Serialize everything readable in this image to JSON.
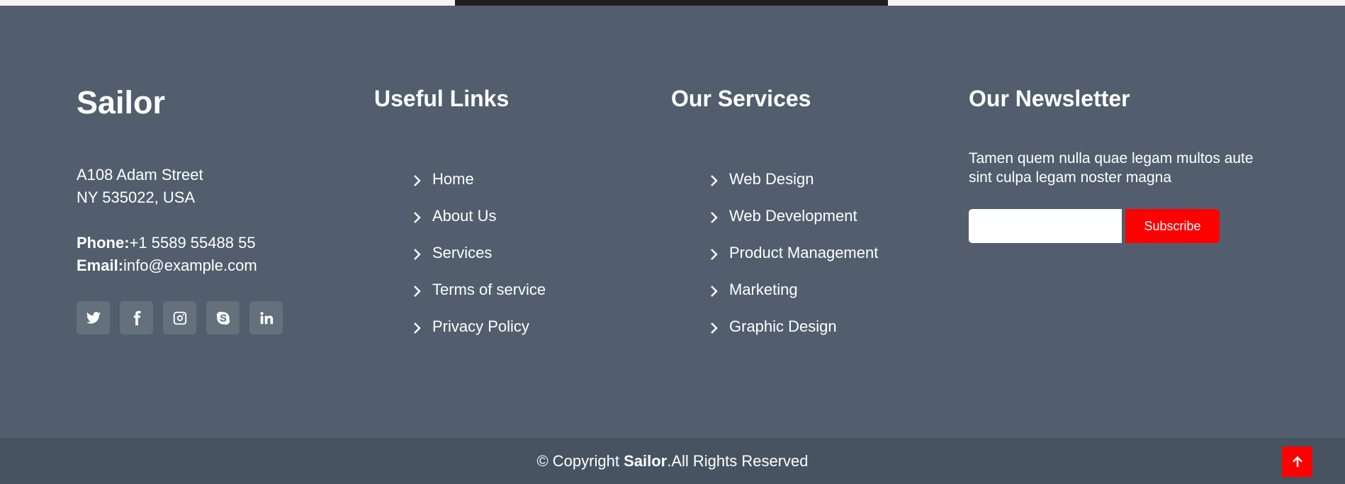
{
  "brand": {
    "name": "Sailor"
  },
  "address": {
    "line1": "A108 Adam Street",
    "line2": "NY 535022, USA"
  },
  "contact": {
    "phone_label": "Phone:",
    "phone": "+1 5589 55488 55",
    "email_label": "Email:",
    "email": "info@example.com"
  },
  "social": [
    "twitter-icon",
    "facebook-icon",
    "instagram-icon",
    "skype-icon",
    "linkedin-icon"
  ],
  "useful_links": {
    "heading": "Useful Links",
    "items": [
      "Home",
      "About Us",
      "Services",
      "Terms of service",
      "Privacy Policy"
    ]
  },
  "services": {
    "heading": "Our Services",
    "items": [
      "Web Design",
      "Web Development",
      "Product Management",
      "Marketing",
      "Graphic Design"
    ]
  },
  "newsletter": {
    "heading": "Our Newsletter",
    "text": "Tamen quem nulla quae legam multos aute sint culpa legam noster magna",
    "input_value": "",
    "button": "Subscribe"
  },
  "copyright": {
    "prefix": "© Copyright ",
    "brand": "Sailor",
    "suffix": ".All Rights Reserved"
  },
  "colors": {
    "footer_bg": "#525e6d",
    "bottom_bar_bg": "#485361",
    "accent": "#ff0000"
  }
}
